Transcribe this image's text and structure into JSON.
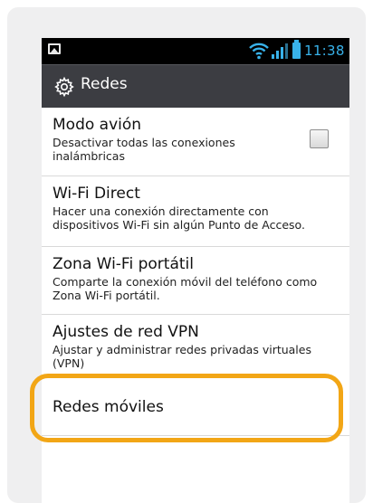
{
  "status_bar": {
    "time": "11:38",
    "icons": [
      "gallery-icon",
      "wifi-icon",
      "signal-icon",
      "battery-icon"
    ],
    "accent_color": "#38b2ea"
  },
  "action_bar": {
    "icon": "gear-icon",
    "title": "Redes"
  },
  "settings": [
    {
      "title": "Modo avión",
      "subtitle": "Desactivar todas las conexiones inalámbricas",
      "checked": false
    },
    {
      "title": "Wi-Fi Direct",
      "subtitle": "Hacer una conexión directamente con dispositivos Wi-Fi sin algún Punto de Acceso."
    },
    {
      "title": "Zona Wi-Fi portátil",
      "subtitle": "Comparte la conexión móvil del teléfono como Zona Wi-Fi portátil."
    },
    {
      "title": "Ajustes de red VPN",
      "subtitle": "Ajustar y administrar redes privadas virtuales (VPN)"
    },
    {
      "title": "Redes móviles",
      "highlighted": true
    }
  ],
  "colors": {
    "highlight": "#f2a616",
    "action_bar": "#3c3d42",
    "frame_background": "#efeff0"
  }
}
